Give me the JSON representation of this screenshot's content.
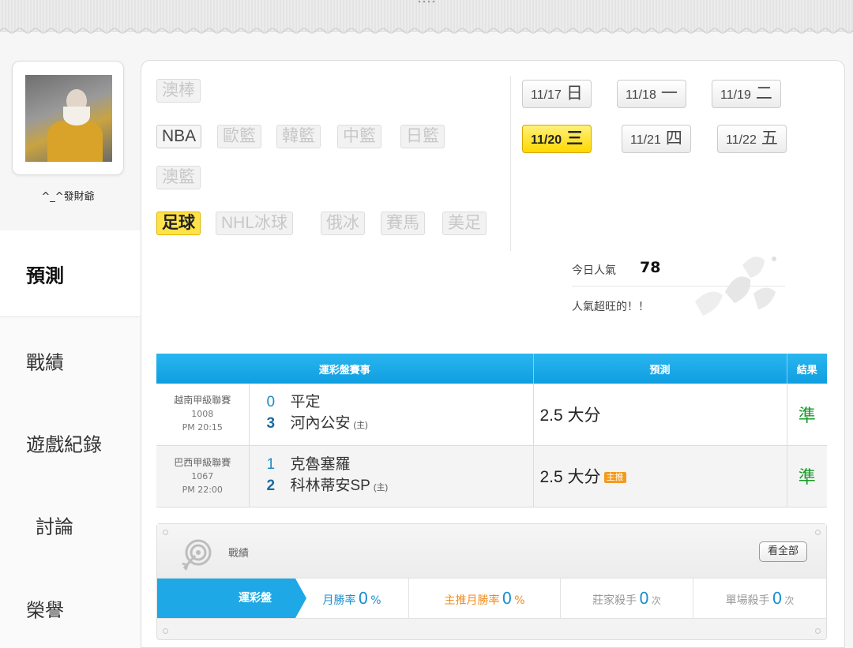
{
  "user": {
    "name": "^_^發財爺"
  },
  "sidebar": {
    "items": [
      {
        "label": "預測",
        "active": true
      },
      {
        "label": "戰績"
      },
      {
        "label": "遊戲紀錄"
      },
      {
        "label": "討論"
      },
      {
        "label": "榮譽"
      }
    ]
  },
  "sport_tags": [
    {
      "label": "澳棒",
      "state": "off"
    },
    {
      "label": "NBA",
      "state": "on"
    },
    {
      "label": "歐籃",
      "state": "off"
    },
    {
      "label": "韓籃",
      "state": "off"
    },
    {
      "label": "中籃",
      "state": "off"
    },
    {
      "label": "日籃",
      "state": "off"
    },
    {
      "label": "澳籃",
      "state": "off"
    },
    {
      "label": "足球",
      "state": "selected"
    },
    {
      "label": "NHL冰球",
      "state": "off"
    },
    {
      "label": "俄冰",
      "state": "off"
    },
    {
      "label": "賽馬",
      "state": "off"
    },
    {
      "label": "美足",
      "state": "off"
    }
  ],
  "dates": [
    {
      "md": "11/17",
      "wd": "日",
      "selected": false
    },
    {
      "md": "11/18",
      "wd": "一",
      "selected": false
    },
    {
      "md": "11/19",
      "wd": "二",
      "selected": false
    },
    {
      "md": "11/20",
      "wd": "三",
      "selected": true
    },
    {
      "md": "11/21",
      "wd": "四",
      "selected": false
    },
    {
      "md": "11/22",
      "wd": "五",
      "selected": false
    }
  ],
  "popularity": {
    "label": "今日人氣",
    "value": "78",
    "note": "人氣超旺的！！"
  },
  "table": {
    "headers": {
      "event": "運彩盤賽事",
      "prediction": "預測",
      "result": "結果"
    },
    "rows": [
      {
        "league": "越南甲級聯賽",
        "number": "1008",
        "time": "PM 20:15",
        "away_score": "0",
        "away_team": "平定",
        "home_score": "3",
        "home_team": "河內公安",
        "home_tag": "(主)",
        "pick": "2.5 大分",
        "main_pick": false,
        "result": "準"
      },
      {
        "league": "巴西甲級聯賽",
        "number": "1067",
        "time": "PM 22:00",
        "away_score": "1",
        "away_team": "克魯塞羅",
        "home_score": "2",
        "home_team": "科林蒂安SP",
        "home_tag": "(主)",
        "pick": "2.5 大分",
        "main_pick": true,
        "main_pick_label": "主推",
        "result": "準"
      }
    ]
  },
  "record": {
    "title": "戰績",
    "see_all": "看全部",
    "tab": "運彩盤",
    "stats": [
      {
        "label": "月勝率",
        "value": "0",
        "unit": "%"
      },
      {
        "label": "主推月勝率",
        "value": "0",
        "unit": "%"
      },
      {
        "label": "莊家殺手",
        "value": "0",
        "unit": "次"
      },
      {
        "label": "單場殺手",
        "value": "0",
        "unit": "次"
      }
    ]
  },
  "colors": {
    "accent_blue": "#1ea8e6",
    "selected_yellow": "#ffd800",
    "win_green": "#1a9a2a",
    "main_orange": "#f59a1b"
  }
}
